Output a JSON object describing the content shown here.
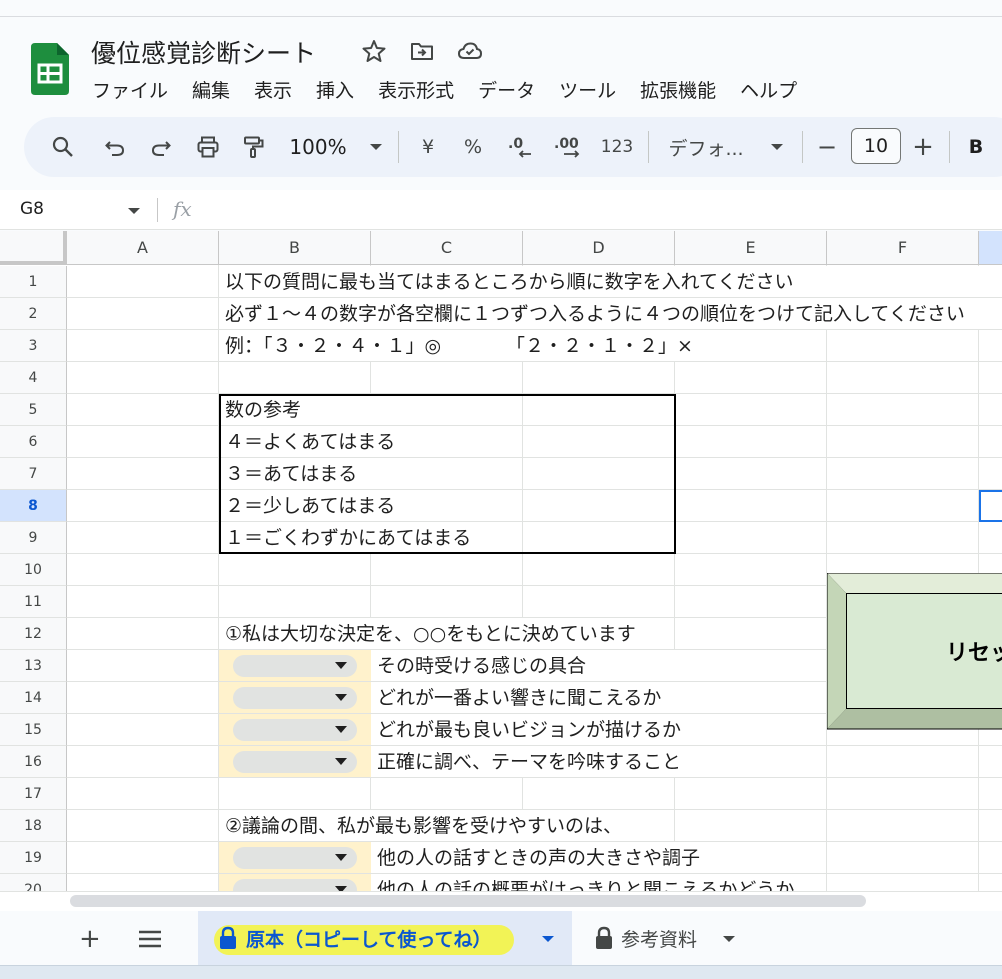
{
  "app": {
    "doc_title": "優位感覚診断シート",
    "menu": [
      "ファイル",
      "編集",
      "表示",
      "挿入",
      "表示形式",
      "データ",
      "ツール",
      "拡張機能",
      "ヘルプ"
    ]
  },
  "toolbar": {
    "zoom": "100%",
    "currency": "¥",
    "percent": "%",
    "dec_decrease": ".0",
    "dec_increase": ".00",
    "number_format": "123",
    "font": "デフォ...",
    "font_size": "10",
    "bold": "B",
    "minus": "−",
    "plus": "+"
  },
  "formula_bar": {
    "name_box": "G8",
    "fx": "fx"
  },
  "columns": [
    "A",
    "B",
    "C",
    "D",
    "E",
    "F"
  ],
  "rows": [
    "1",
    "2",
    "3",
    "4",
    "5",
    "6",
    "7",
    "8",
    "9",
    "10",
    "11",
    "12",
    "13",
    "14",
    "15",
    "16",
    "17",
    "18",
    "19",
    "20"
  ],
  "selected_row": "8",
  "cells": {
    "r1": "以下の質問に最も当てはまるところから順に数字を入れてください",
    "r2": "必ず１～４の数字が各空欄に１つずつ入るように４つの順位をつけて記入してください",
    "r3a": "例：「３・２・４・１」◎",
    "r3b": "「２・２・１・２」×",
    "r5": "数の参考",
    "r6": "４＝よくあてはまる",
    "r7": "３＝あてはまる",
    "r8": "２＝少しあてはまる",
    "r9": "１＝ごくわずかにあてはまる",
    "q1": "①私は大切な決定を、○○をもとに決めています",
    "q1_opts": [
      "その時受ける感じの具合",
      "どれが一番よい響きに聞こえるか",
      "どれが最も良いビジョンが描けるか",
      "正確に調べ、テーマを吟味すること"
    ],
    "q2": "②議論の間、私が最も影響を受けやすいのは、",
    "q2_opts": [
      "他の人の話すときの声の大きさや調子",
      "他の人の話の概要がはっきりと聞こえるかどうか"
    ]
  },
  "reset_button": "リセット",
  "sheets": {
    "add": "+",
    "active": "原本（コピーして使ってね）",
    "other": "参考資料"
  },
  "colors": {
    "dropdown_bg": "#fff2cc",
    "reset_bg": "#d9ead3",
    "active_tab": "#0b57d0",
    "highlight": "#f5f53a"
  }
}
